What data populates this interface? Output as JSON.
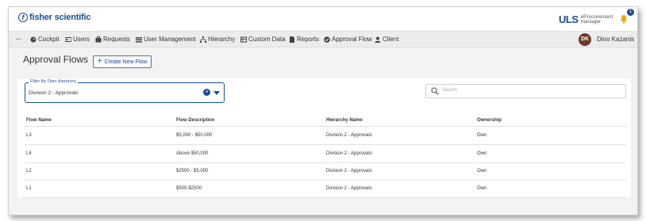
{
  "brand": {
    "logo_text": "fisher scientific",
    "uls_mark": "ULS",
    "uls_sub_line1": "eProcurement",
    "uls_sub_line2": "manager"
  },
  "notifications": {
    "count": "1"
  },
  "nav": {
    "back": "←",
    "items": [
      {
        "label": "Cockpit",
        "icon": "cockpit-icon"
      },
      {
        "label": "Users",
        "icon": "users-icon"
      },
      {
        "label": "Requests",
        "icon": "requests-icon"
      },
      {
        "label": "User Management",
        "icon": "user-management-icon"
      },
      {
        "label": "Hierarchy",
        "icon": "hierarchy-icon"
      },
      {
        "label": "Custom Data",
        "icon": "custom-data-icon"
      },
      {
        "label": "Reports",
        "icon": "reports-icon"
      },
      {
        "label": "Approval Flow",
        "icon": "approval-flow-icon"
      },
      {
        "label": "Client",
        "icon": "client-icon"
      }
    ]
  },
  "user": {
    "initials": "DK",
    "name": "Dino Kazanis"
  },
  "page": {
    "title": "Approval Flows",
    "create_label": "Create New Flow"
  },
  "filter": {
    "label": "Filter By Own Hierarchy",
    "value": "Division 2 - Approvals"
  },
  "search": {
    "placeholder": "Search"
  },
  "table": {
    "headers": [
      "Flow Name",
      "Flow Description",
      "Hierarchy Name",
      "Ownership"
    ],
    "rows": [
      [
        "L3",
        "$5,000 - $50,000",
        "Division 2 - Approvals",
        "Own"
      ],
      [
        "L4",
        "Above $50,000",
        "Division 2 - Approvals",
        "Own"
      ],
      [
        "L2",
        "$2500 - $5,000",
        "Division 2 - Approvals",
        "Own"
      ],
      [
        "L1",
        "$500-$2500",
        "Division 2 - Approvals",
        "Own"
      ]
    ]
  },
  "colors": {
    "accent": "#1a4e96",
    "avatar": "#6d3a2a",
    "bell": "#f2a900"
  }
}
